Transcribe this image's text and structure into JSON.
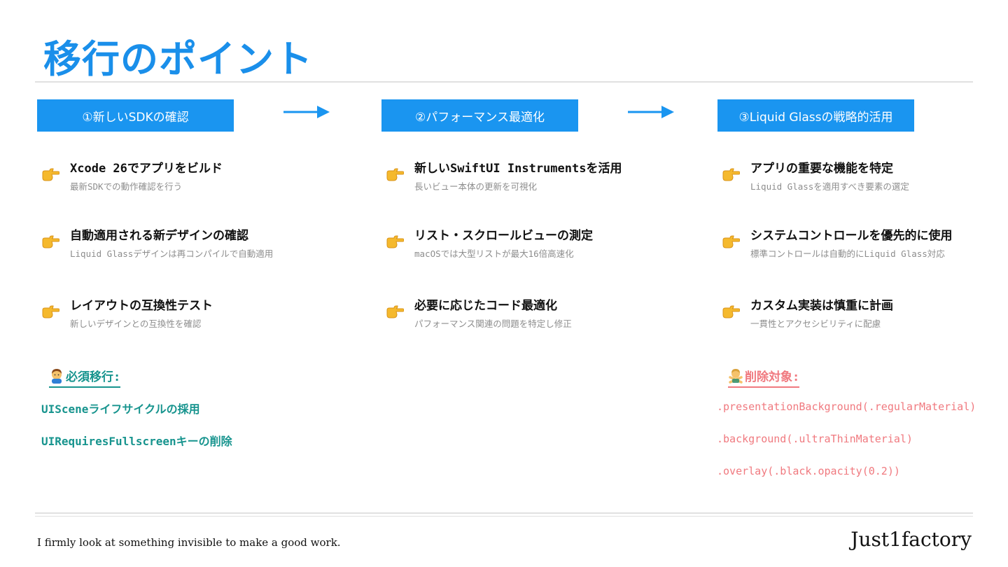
{
  "slide": {
    "title": "移行のポイント"
  },
  "columns": [
    {
      "step_label": "①新しいSDKの確認",
      "items": [
        {
          "title": "Xcode 26でアプリをビルド",
          "subtitle": "最新SDKでの動作確認を行う"
        },
        {
          "title": "自動適用される新デザインの確認",
          "subtitle": "Liquid Glassデザインは再コンパイルで自動適用"
        },
        {
          "title": "レイアウトの互換性テスト",
          "subtitle": "新しいデザインとの互換性を確認"
        }
      ]
    },
    {
      "step_label": "②パフォーマンス最適化",
      "items": [
        {
          "title": "新しいSwiftUI Instrumentsを活用",
          "subtitle": "長いビュー本体の更新を可視化"
        },
        {
          "title": "リスト・スクロールビューの測定",
          "subtitle": "macOSでは大型リストが最大16倍高速化"
        },
        {
          "title": "必要に応じたコード最適化",
          "subtitle": "パフォーマンス関連の問題を特定し修正"
        }
      ]
    },
    {
      "step_label": "③Liquid Glassの戦略的活用",
      "items": [
        {
          "title": "アプリの重要な機能を特定",
          "subtitle": "Liquid Glassを適用すべき要素の選定"
        },
        {
          "title": "システムコントロールを優先的に使用",
          "subtitle": "標準コントロールは自動的にLiquid Glass対応"
        },
        {
          "title": "カスタム実装は慎重に計画",
          "subtitle": "一貫性とアクセシビリティに配慮"
        }
      ]
    }
  ],
  "required_migration": {
    "heading": "必須移行:",
    "items": [
      "UISceneライフサイクルの採用",
      "UIRequiresFullscreenキーの削除"
    ]
  },
  "removal_targets": {
    "heading": "削除対象:",
    "items": [
      ".presentationBackground(.regularMaterial)",
      ".background(.ultraThinMaterial)",
      ".overlay(.black.opacity(0.2))"
    ]
  },
  "footer": {
    "tagline": "I firmly look at something invisible to make a good work.",
    "brand": "Just1factory"
  },
  "colors": {
    "title": "#1a8fea",
    "step_box": "#1a95f0",
    "teal": "#17948e",
    "coral": "#f0797f"
  },
  "icons": {
    "arrow": "right-arrow-icon",
    "bullet": "pointing-hand-icon",
    "required": "person-gesturing-ok-icon",
    "removal": "person-gesturing-no-icon"
  }
}
